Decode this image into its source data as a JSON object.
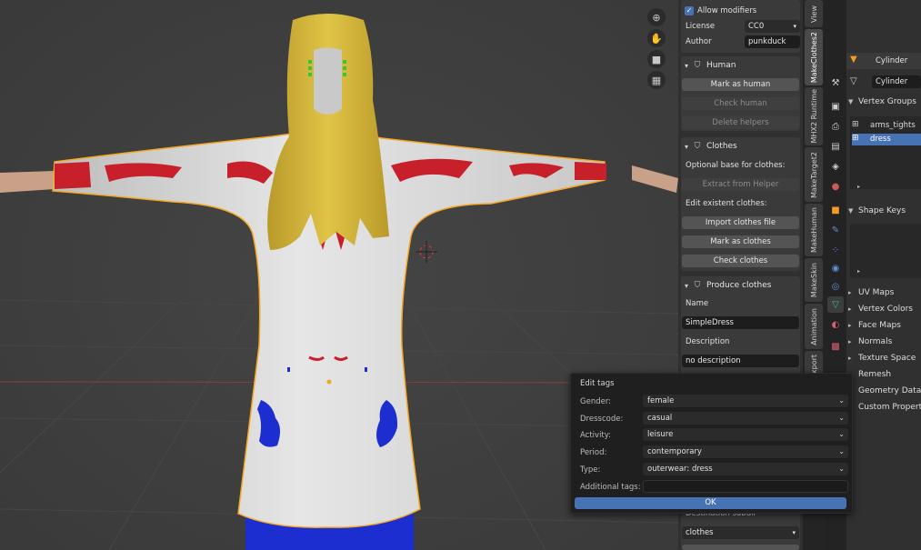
{
  "viewport": {
    "tools": [
      {
        "name": "zoom-icon",
        "glyph": "⊕"
      },
      {
        "name": "pan-hand-icon",
        "glyph": "✋"
      },
      {
        "name": "camera-icon",
        "glyph": "■"
      },
      {
        "name": "grid-view-icon",
        "glyph": "▦"
      }
    ]
  },
  "npanel": {
    "allow_modifiers_label": "Allow modifiers",
    "license_label": "License",
    "license_value": "CC0",
    "author_label": "Author",
    "author_value": "punkduck",
    "human": {
      "title": "Human",
      "mark_as_human": "Mark as human",
      "check_human": "Check human",
      "delete_helpers": "Delete helpers"
    },
    "clothes": {
      "title": "Clothes",
      "optional_base": "Optional base for clothes:",
      "extract_from_helper": "Extract from Helper",
      "edit_existent": "Edit existent clothes:",
      "import_clothes_file": "Import clothes file",
      "mark_as_clothes": "Mark as clothes",
      "check_clothes": "Check clothes"
    },
    "produce": {
      "title": "Produce clothes",
      "name_label": "Name",
      "name_value": "SimpleDress",
      "description_label": "Description",
      "description_value": "no description",
      "destination_label": "Destination subdir",
      "destination_value": "clothes"
    }
  },
  "tabs": [
    {
      "label": "View",
      "active": false
    },
    {
      "label": "MakeClothes2",
      "active": true
    },
    {
      "label": "MHX2 Runtime",
      "active": false
    },
    {
      "label": "MakeTarget2",
      "active": false
    },
    {
      "label": "MakeHuman",
      "active": false
    },
    {
      "label": "MakeSkin",
      "active": false
    },
    {
      "label": "Animation",
      "active": false
    },
    {
      "label": "Export",
      "active": false
    }
  ],
  "properties": {
    "object_name": "Cylinder",
    "mesh_name": "Cylinder",
    "vertex_groups_title": "Vertex Groups",
    "vertex_groups": [
      "arms_tights",
      "dress"
    ],
    "shape_keys_title": "Shape Keys",
    "collapsed_sections": [
      "UV Maps",
      "Vertex Colors",
      "Face Maps",
      "Normals",
      "Texture Space",
      "Remesh",
      "Geometry Data",
      "Custom Properties"
    ]
  },
  "dialog": {
    "title": "Edit tags",
    "fields": [
      {
        "label": "Gender:",
        "value": "female"
      },
      {
        "label": "Dresscode:",
        "value": "casual"
      },
      {
        "label": "Activity:",
        "value": "leisure"
      },
      {
        "label": "Period:",
        "value": "contemporary"
      },
      {
        "label": "Type:",
        "value": "outerwear: dress"
      }
    ],
    "additional_tags_label": "Additional tags:",
    "additional_tags_value": "",
    "ok_label": "OK"
  },
  "colors": {
    "accent": "#4772b3",
    "selection_outline": "#f5a623",
    "dialog_bg": "#1f1f1f"
  }
}
